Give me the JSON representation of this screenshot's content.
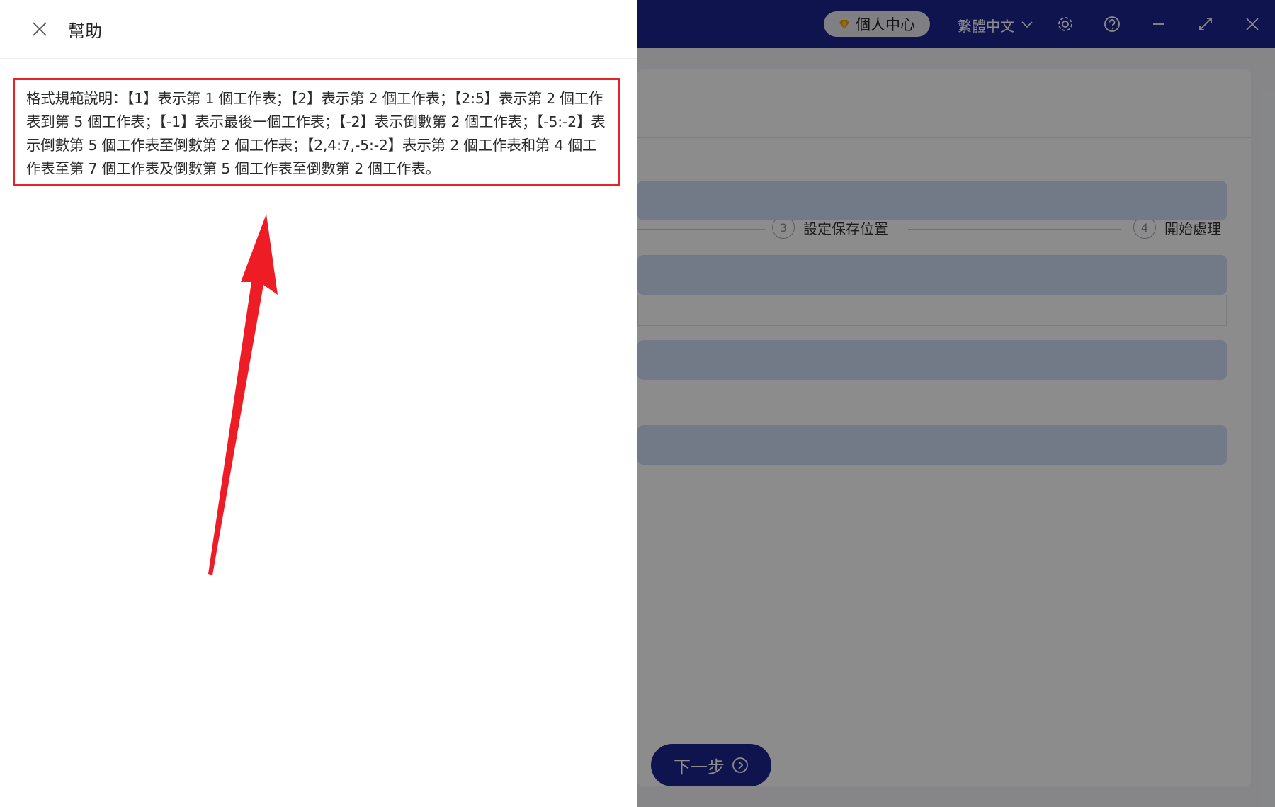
{
  "titlebar": {
    "vip_label": "個人中心",
    "language": "繁體中文",
    "icons": [
      "diamond-icon",
      "chevron-down-icon",
      "gear-icon",
      "help-icon",
      "minimize-icon",
      "maximize-icon",
      "close-icon"
    ]
  },
  "steps": [
    {
      "number": "3",
      "label": "設定保存位置"
    },
    {
      "number": "4",
      "label": "開始處理"
    }
  ],
  "actions": {
    "next_label": "下一步"
  },
  "help": {
    "title": "幫助",
    "text": "格式規範說明：【1】表示第 1 個工作表；【2】表示第 2 個工作表；【2:5】表示第 2 個工作表到第 5 個工作表；【-1】表示最後一個工作表；【-2】表示倒數第 2 個工作表；【-5:-2】表示倒數第 5 個工作表至倒數第 2 個工作表；【2,4:7,-5:-2】表示第 2 個工作表和第 4 個工作表至第 7 個工作表及倒數第 5 個工作表至倒數第 2 個工作表。"
  },
  "colors": {
    "brand": "#1d2590",
    "highlight": "#e8212b",
    "section_bar": "#d0dcf6",
    "vip_diamond": "#f0a500"
  }
}
